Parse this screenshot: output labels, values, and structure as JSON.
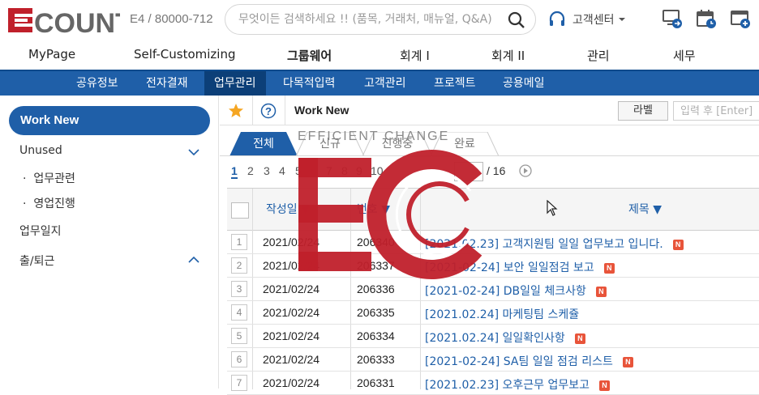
{
  "top": {
    "company": "E4 / 80000-712",
    "search_placeholder": "무엇이든 검색하세요 !! (품목, 거래처, 매뉴얼, Q&A)",
    "customer_center": "고객센터"
  },
  "main_nav": [
    "MyPage",
    "Self-Customizing",
    "그룹웨어",
    "회계 I",
    "회계 II",
    "관리",
    "세무"
  ],
  "main_nav_active": "그룹웨어",
  "sub_nav": [
    "공유정보",
    "전자결재",
    "업무관리",
    "다목적입력",
    "고객관리",
    "프로젝트",
    "공용메일"
  ],
  "sub_nav_active": "업무관리",
  "sidebar": {
    "work_new": "Work New",
    "unused": "Unused",
    "sub1": "업무관련",
    "sub2": "영업진행",
    "daily": "업무일지",
    "attendance": "출/퇴근"
  },
  "content": {
    "title": "Work New",
    "label_button": "라벨",
    "label_placeholder": "입력 후 [Enter]",
    "tabs": [
      "전체",
      "신규",
      "진행중",
      "완료"
    ],
    "pages": [
      "1",
      "2",
      "3",
      "4",
      "5",
      "6",
      "7",
      "8",
      "9",
      "10"
    ],
    "page_total": "/ 16",
    "columns": {
      "date": "작성일",
      "no": "번호",
      "title": "제목"
    },
    "rows": [
      {
        "num": "1",
        "date": "2021/02/24",
        "no": "206340",
        "title": "[2021.02.23] 고객지원팀 일일 업무보고 입니다."
      },
      {
        "num": "2",
        "date": "2021/02/24",
        "no": "206337",
        "title": "[2021-02-24] 보안 일일점검 보고"
      },
      {
        "num": "3",
        "date": "2021/02/24",
        "no": "206336",
        "title": "[2021-02-24] DB일일 체크사항"
      },
      {
        "num": "4",
        "date": "2021/02/24",
        "no": "206335",
        "title": "[2021.02.24] 마케팅팀 스케쥴"
      },
      {
        "num": "5",
        "date": "2021/02/24",
        "no": "206334",
        "title": "[2021.02.24] 일일확인사항"
      },
      {
        "num": "6",
        "date": "2021/02/24",
        "no": "206333",
        "title": "[2021-02-24] SA팀 일일 점검 리스트"
      },
      {
        "num": "7",
        "date": "2021/02/24",
        "no": "206331",
        "title": "[2021.02.23] 오후근무 업무보고"
      }
    ],
    "new_badge": "N"
  },
  "overlay_text": "EFFICIENT CHANGE",
  "colors": {
    "brand_blue": "#1f5fa8",
    "brand_red": "#c0202b",
    "new_badge": "#e8543a"
  }
}
